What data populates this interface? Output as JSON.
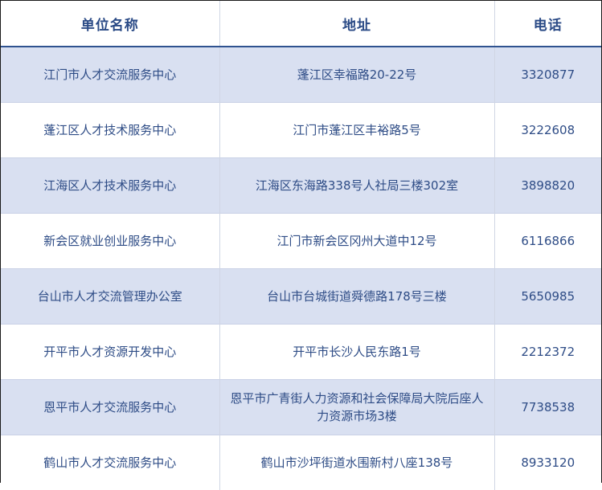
{
  "table": {
    "headers": [
      "单位名称",
      "地址",
      "电话"
    ],
    "rows": [
      {
        "name": "江门市人才交流服务中心",
        "address": "蓬江区幸福路20-22号",
        "phone": "3320877"
      },
      {
        "name": "蓬江区人才技术服务中心",
        "address": "江门市蓬江区丰裕路5号",
        "phone": "3222608"
      },
      {
        "name": "江海区人才技术服务中心",
        "address": "江海区东海路338号人社局三楼302室",
        "phone": "3898820"
      },
      {
        "name": "新会区就业创业服务中心",
        "address": "江门市新会区冈州大道中12号",
        "phone": "6116866"
      },
      {
        "name": "台山市人才交流管理办公室",
        "address": "台山市台城街道舜德路178号三楼",
        "phone": "5650985"
      },
      {
        "name": "开平市人才资源开发中心",
        "address": "开平市长沙人民东路1号",
        "phone": "2212372"
      },
      {
        "name": "恩平市人才交流服务中心",
        "address": "恩平市广青街人力资源和社会保障局大院后座人力资源市场3楼",
        "phone": "7738538"
      },
      {
        "name": "鹤山市人才交流服务中心",
        "address": "鹤山市沙坪街道水围新村八座138号",
        "phone": "8933120"
      }
    ]
  },
  "colors": {
    "header_text": "#2a4a86",
    "cell_text": "#2e4c86",
    "stripe": "#d9e0f1",
    "header_rule": "#2f528f"
  }
}
